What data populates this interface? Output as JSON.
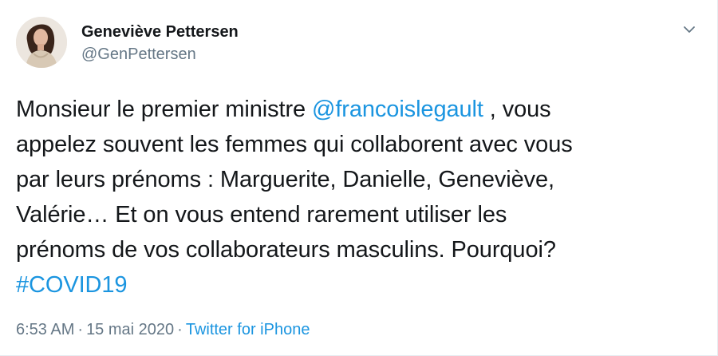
{
  "author": {
    "name": "Geneviève Pettersen",
    "handle": "@GenPettersen"
  },
  "tweet": {
    "lines": [
      {
        "before": "Monsieur le premier ministre ",
        "mention": "@francoislegault",
        "after": " , vous"
      },
      {
        "text": "appelez souvent les femmes qui collaborent avec vous"
      },
      {
        "text": "par leurs prénoms : Marguerite, Danielle, Geneviève,"
      },
      {
        "text": "Valérie… Et on vous entend rarement utiliser les"
      },
      {
        "text": "prénoms de vos collaborateurs masculins. Pourquoi?"
      },
      {
        "hashtag": "#COVID19"
      }
    ]
  },
  "meta": {
    "time": "6:53 AM",
    "separator": "·",
    "date": "15 mai 2020",
    "source": "Twitter for iPhone"
  },
  "icons": {
    "menu": "chevron-down-icon",
    "avatar": "profile-photo"
  },
  "colors": {
    "link": "#1b95e0",
    "text": "#14171a",
    "muted": "#657786"
  }
}
